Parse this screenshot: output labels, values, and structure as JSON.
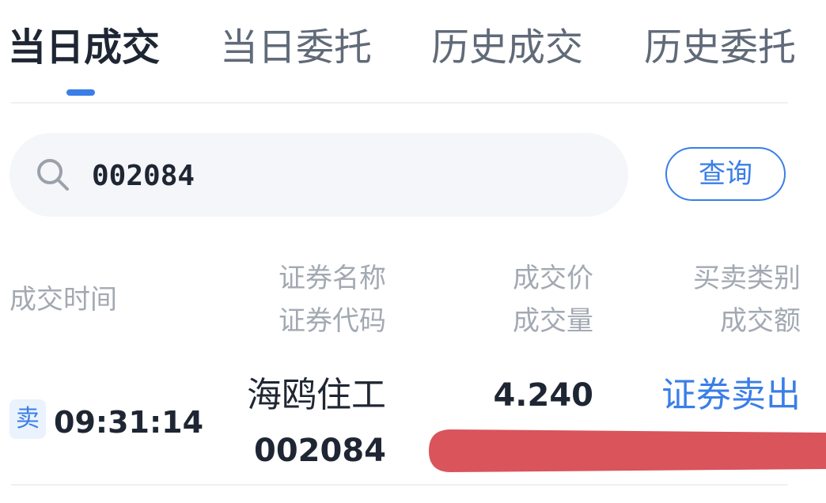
{
  "tabs": [
    {
      "label": "当日成交",
      "active": true
    },
    {
      "label": "当日委托",
      "active": false
    },
    {
      "label": "历史成交",
      "active": false
    },
    {
      "label": "历史委托",
      "active": false
    }
  ],
  "search": {
    "icon": "search-icon",
    "value": "002084",
    "button_label": "查询"
  },
  "table": {
    "headers": {
      "time": "成交时间",
      "name": "证券名称",
      "code": "证券代码",
      "price": "成交价",
      "volume": "成交量",
      "type": "买卖类别",
      "amount": "成交额"
    },
    "rows": [
      {
        "badge": "卖",
        "time": "09:31:14",
        "name": "海鸥住工",
        "code": "002084",
        "price": "4.240",
        "type": "证券卖出"
      }
    ]
  },
  "colors": {
    "accent": "#3a7ee8",
    "redaction": "#d9545b"
  }
}
